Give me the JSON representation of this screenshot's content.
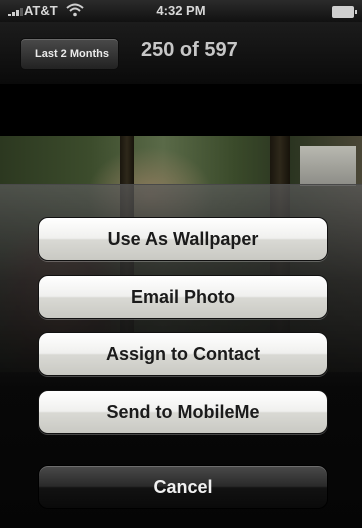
{
  "status_bar": {
    "carrier": "AT&T",
    "time": "4:32 PM",
    "signal_icon": "signal-bars-icon",
    "wifi_icon": "wifi-icon",
    "battery_icon": "battery-icon"
  },
  "nav": {
    "back_label": "Last 2 Months",
    "title": "250 of 597"
  },
  "action_sheet": {
    "buttons": [
      {
        "label": "Use As Wallpaper"
      },
      {
        "label": "Email Photo"
      },
      {
        "label": "Assign to Contact"
      },
      {
        "label": "Send to MobileMe"
      }
    ],
    "cancel_label": "Cancel"
  }
}
